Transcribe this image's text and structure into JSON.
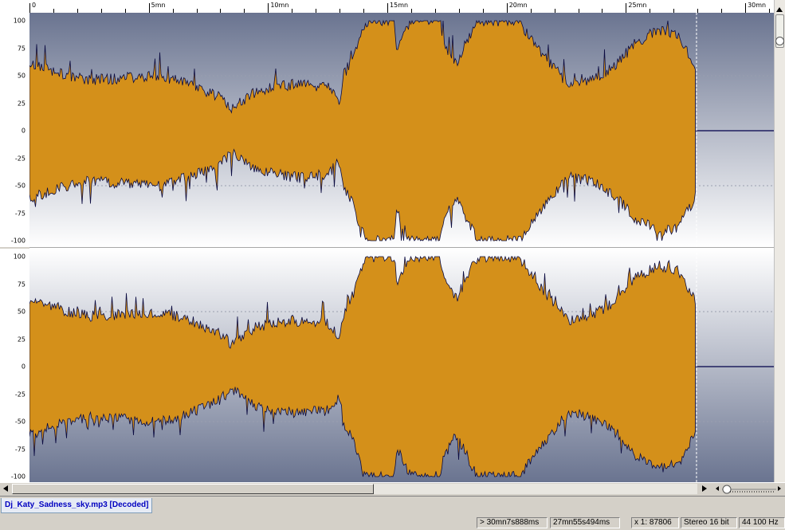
{
  "ruler": {
    "labels": [
      "0",
      "5mn",
      "10mn",
      "15mn",
      "20mn",
      "25mn",
      "30mn"
    ]
  },
  "yaxis": {
    "labels": [
      "100",
      "75",
      "50",
      "25",
      "0",
      "-25",
      "-50",
      "-75",
      "-100"
    ]
  },
  "waveform": {
    "fill_color": "#d4901a",
    "edge_color": "#0a0a40",
    "bg_top": "#6a7490",
    "bg_bottom": "#ffffff",
    "zero_line_color": "#00004a",
    "total_minutes": 27.925,
    "visible_minutes": 31.2,
    "cursor_minutes": 27.925
  },
  "file_tab": {
    "label": "Dj_Katy_Sadness_sky.mp3 [Decoded]"
  },
  "status": {
    "position": "> 30mn7s888ms",
    "duration": "27mn55s494ms",
    "zoom": "x 1: 87806",
    "format": "Stereo 16 bit",
    "rate": "44 100 Hz"
  },
  "icons": {
    "scroll_left": "arrow-left-icon",
    "scroll_right": "arrow-right-icon",
    "zoom_slider": "zoom-slider-icon"
  }
}
